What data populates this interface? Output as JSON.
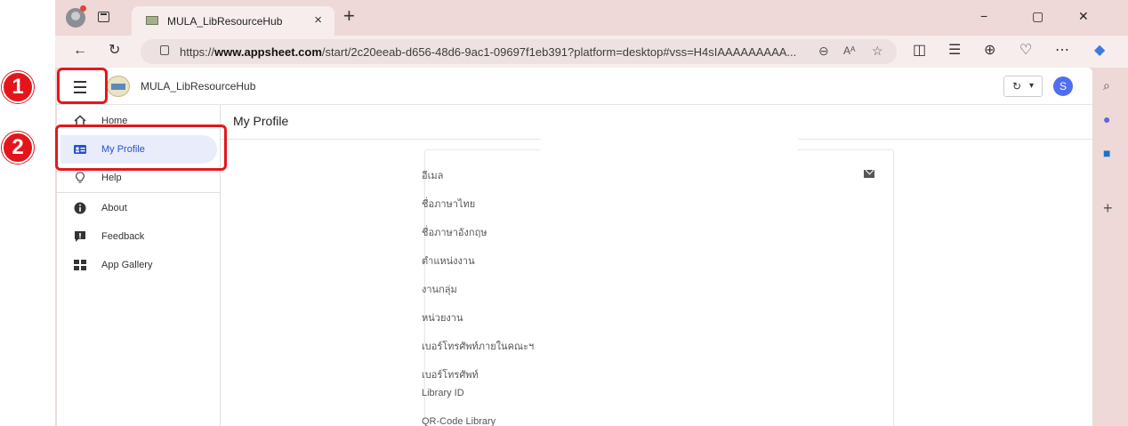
{
  "browser": {
    "tab_title": "MULA_LibResourceHub",
    "tab_close": "×",
    "new_tab": "+",
    "url_prefix": "https://",
    "url_domain": "www.appsheet.com",
    "url_rest": "/start/2c20eeab-d656-48d6-9ac1-09697f1eb391?platform=desktop#vss=H4sIAAAAAAAAA...",
    "window_buttons": [
      "−",
      "▢",
      "✕"
    ]
  },
  "app": {
    "name": "MULA_LibResourceHub",
    "user_initial": "S",
    "sync_icon": "↻",
    "sync_caret": "▾"
  },
  "sidebar": {
    "items": [
      {
        "label": "Home",
        "icon": "home-icon"
      },
      {
        "label": "My Profile",
        "icon": "profile-card-icon",
        "active": true
      },
      {
        "label": "Help",
        "icon": "lightbulb-icon"
      },
      {
        "label": "About",
        "icon": "info-icon"
      },
      {
        "label": "Feedback",
        "icon": "feedback-icon"
      },
      {
        "label": "App Gallery",
        "icon": "grid-icon"
      }
    ]
  },
  "content": {
    "title": "My Profile",
    "fields": [
      "อีเมล",
      "ชื่อภาษาไทย",
      "ชื่อภาษาอังกฤษ",
      "ตำแหน่งงาน",
      "งานกลุ่ม",
      "หน่วยงาน",
      "เบอร์โทรศัพท์ภายในคณะฯ",
      "เบอร์โทรศัพท์",
      "Library ID",
      "QR-Code Library"
    ]
  },
  "callouts": {
    "one": "1",
    "two": "2",
    "color": "#e3151b"
  }
}
